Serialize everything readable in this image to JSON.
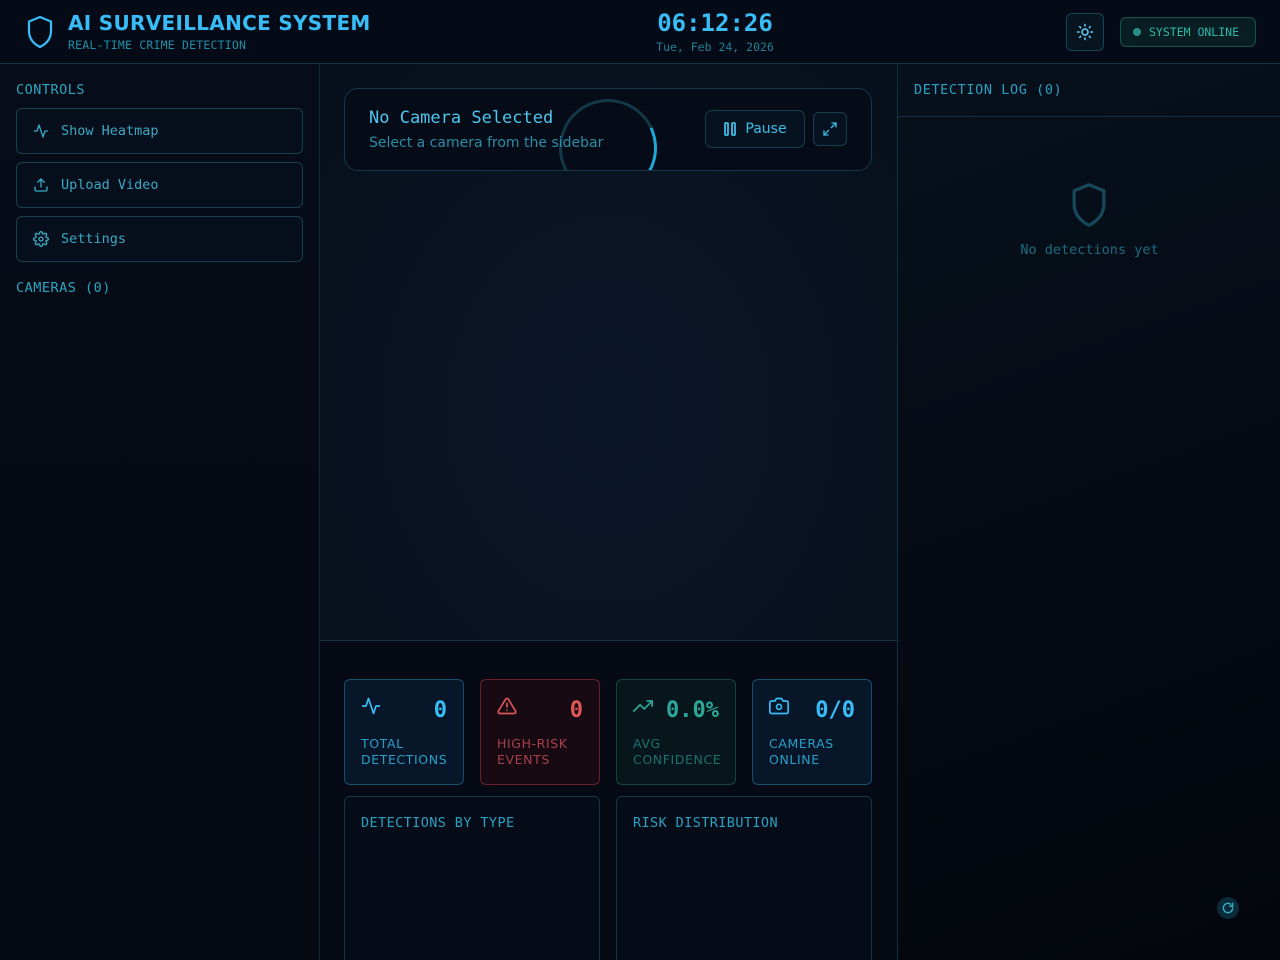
{
  "header": {
    "title": "AI SURVEILLANCE SYSTEM",
    "subtitle": "REAL-TIME CRIME DETECTION",
    "clock": "06:12:26",
    "date": "Tue, Feb 24, 2026",
    "status": "SYSTEM ONLINE"
  },
  "sidebar": {
    "controls_label": "CONTROLS",
    "buttons": [
      {
        "label": "Show Heatmap",
        "icon": "activity-icon"
      },
      {
        "label": "Upload Video",
        "icon": "upload-icon"
      },
      {
        "label": "Settings",
        "icon": "gear-icon"
      }
    ],
    "cameras_label": "CAMERAS (0)"
  },
  "camera": {
    "title": "No Camera Selected",
    "subtitle": "Select a camera from the sidebar",
    "pause_label": "Pause"
  },
  "stats": [
    {
      "value": "0",
      "label": "TOTAL DETECTIONS",
      "icon": "activity-icon",
      "color": "#38bdf8"
    },
    {
      "value": "0",
      "label": "HIGH-RISK EVENTS",
      "icon": "alert-triangle-icon",
      "color": "#e05858"
    },
    {
      "value": "0.0%",
      "label": "AVG CONFIDENCE",
      "icon": "trending-up-icon",
      "color": "#2aa89a"
    },
    {
      "value": "0/0",
      "label": "CAMERAS ONLINE",
      "icon": "camera-icon",
      "color": "#38bdf8"
    }
  ],
  "charts": {
    "by_type_title": "DETECTIONS BY TYPE",
    "risk_title": "RISK DISTRIBUTION"
  },
  "log": {
    "title": "DETECTION LOG (0)",
    "empty": "No detections yet"
  }
}
